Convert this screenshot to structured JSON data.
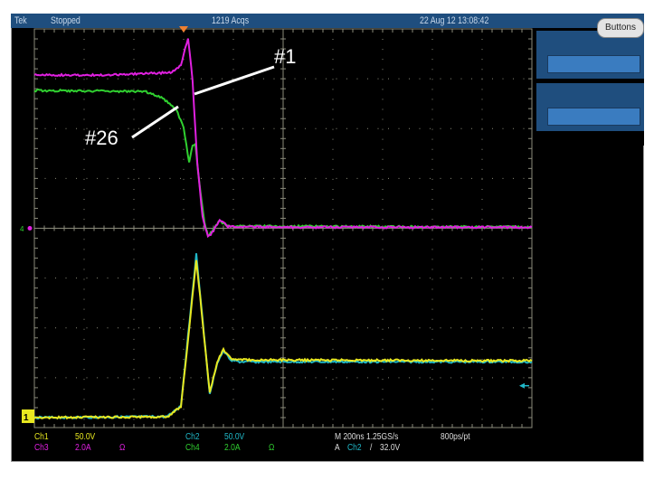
{
  "header": {
    "brand": "Tek",
    "status": "Stopped",
    "acquisitions": "1219 Acqs",
    "datetime": "22 Aug 12 13:08:42"
  },
  "side_panel": {
    "buttons_label": "Buttons",
    "softkeys": [
      "",
      ""
    ]
  },
  "colors": {
    "ch1": "#e8e820",
    "ch2": "#20b8c8",
    "ch3": "#e020e0",
    "ch4": "#30d030",
    "header": "#1f4e7e",
    "softkey": "#3a7cc0"
  },
  "ground_markers": {
    "ch1": "1",
    "ch34": "4"
  },
  "readout": {
    "ch1": {
      "label": "Ch1",
      "scale": "50.0V"
    },
    "ch2": {
      "label": "Ch2",
      "scale": "50.0V"
    },
    "ch3": {
      "label": "Ch3",
      "scale": "2.0A",
      "coupling": "Ω"
    },
    "ch4": {
      "label": "Ch4",
      "scale": "2.0A",
      "coupling": "Ω"
    },
    "timebase": "M 200ns 1.25GS/s",
    "resolution": "800ps/pt",
    "trigger": {
      "prefix": "A",
      "source": "Ch2",
      "slope": "/",
      "level": "32.0V"
    }
  },
  "annotations": [
    "#1",
    "#26"
  ],
  "chart_data": {
    "type": "line",
    "xlabel": "",
    "ylabel": "",
    "x_unit": "ns",
    "time_per_div": 200,
    "divisions": [
      10,
      8
    ],
    "xlim": [
      -600,
      1400
    ],
    "grid": true,
    "series": [
      {
        "name": "Ch3",
        "unit": "A",
        "per_div": 2.0,
        "ground_div": 0,
        "x": [
          -600,
          -300,
          -47,
          -11,
          18,
          36,
          55,
          76,
          98,
          120,
          145,
          178,
          400,
          800,
          1400
        ],
        "y": [
          6.15,
          6.15,
          6.25,
          6.55,
          7.64,
          5.9,
          2.6,
          0.44,
          -0.36,
          -0.1,
          0.36,
          0.07,
          0.04,
          0.04,
          0.04
        ]
      },
      {
        "name": "Ch4",
        "unit": "A",
        "per_div": 2.0,
        "ground_div": 0,
        "x": [
          -600,
          -156,
          -84,
          -29,
          0,
          22,
          36,
          47,
          62,
          84,
          98,
          120,
          145,
          178,
          1400
        ],
        "y": [
          5.53,
          5.49,
          5.24,
          4.73,
          4.07,
          2.62,
          3.35,
          3.4,
          1.89,
          0.25,
          -0.3,
          -0.05,
          0.3,
          0.08,
          0.05
        ]
      },
      {
        "name": "Ch1",
        "unit": "V",
        "per_div": 50.0,
        "ground_div": -3.8,
        "x": [
          -600,
          -65,
          -11,
          18,
          51,
          76,
          105,
          135,
          160,
          189,
          225,
          1400
        ],
        "y": [
          0,
          0.9,
          10.9,
          79,
          159,
          97,
          24.5,
          56,
          68,
          59,
          58,
          57
        ]
      },
      {
        "name": "Ch2",
        "unit": "V",
        "per_div": 50.0,
        "ground_div": -3.8,
        "x": [
          -600,
          -65,
          -11,
          18,
          51,
          76,
          105,
          135,
          160,
          189,
          225,
          1400
        ],
        "y": [
          0,
          1,
          12,
          83,
          164,
          99,
          23,
          55,
          67,
          58,
          56,
          56
        ]
      }
    ],
    "trigger": {
      "time": 0,
      "source": "Ch2",
      "level": 32.0
    }
  }
}
